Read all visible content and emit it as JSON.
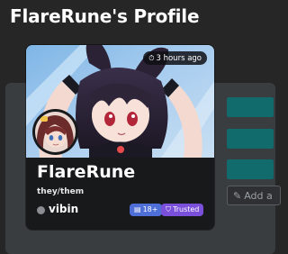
{
  "page": {
    "title": "FlareRune's Profile"
  },
  "profile": {
    "display_name": "FlareRune",
    "pronouns": "they/them",
    "status": "vibin",
    "last_seen": "3 hours ago",
    "badges": [
      {
        "label": "18+",
        "icon": "id-card-icon",
        "color": "#4f6fd8"
      },
      {
        "label": "Trusted",
        "icon": "shield-icon",
        "color": "#7a4fd9"
      }
    ],
    "status_color": "#8a8d91"
  },
  "side_panel": {
    "add_placeholder": "Add a"
  },
  "colors": {
    "background": "#262626",
    "card": "#18191b",
    "teal_accent": "#116a6c"
  }
}
